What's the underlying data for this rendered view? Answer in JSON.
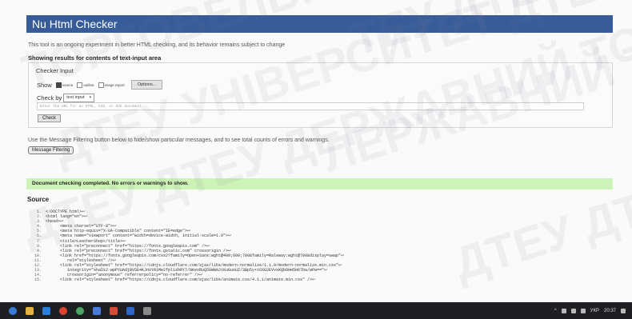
{
  "header": {
    "title": "Nu Html Checker"
  },
  "intro": "This tool is an ongoing experiment in better HTML checking, and its behavior remains subject to change",
  "showing": "Showing results for contents of text-input area",
  "checker": {
    "legend": "Checker Input",
    "show_label": "Show",
    "show_options": [
      {
        "label": "source",
        "checked": true
      },
      {
        "label": "outline",
        "checked": false
      },
      {
        "label": "image report",
        "checked": false
      }
    ],
    "options_button": "Options...",
    "check_by_label": "Check by",
    "check_by_value": "text input",
    "url_placeholder": "Enter the URL for an HTML, CSS, or SVG document",
    "check_button": "Check"
  },
  "filtering": {
    "text": "Use the Message Filtering button below to hide/show particular messages, and to see total counts of errors and warnings.",
    "button": "Message Filtering"
  },
  "status": "Document checking completed. No errors or warnings to show.",
  "source_heading": "Source",
  "code_lines": [
    {
      "n": "1.",
      "text": "<!DOCTYPE html>↩"
    },
    {
      "n": "2.",
      "text": "<html lang=\"en\">↩"
    },
    {
      "n": "3.",
      "text": "<head>↩"
    },
    {
      "n": "4.",
      "text": "      <meta charset=\"UTF-8\">↩"
    },
    {
      "n": "5.",
      "text": "      <meta http-equiv=\"X-UA-Compatible\" content=\"IE=edge\">↩"
    },
    {
      "n": "6.",
      "text": "      <meta name=\"viewport\" content=\"width=device-width, initial-scale=1.0\">↩"
    },
    {
      "n": "7.",
      "text": "      <title>LeatherShop</title>↩"
    },
    {
      "n": "8.",
      "text": "      <link rel=\"preconnect\" href=\"https://fonts.googleapis.com\" />↩"
    },
    {
      "n": "9.",
      "text": "      <link rel=\"preconnect\" href=\"https://fonts.gstatic.com\" crossorigin />↩"
    },
    {
      "n": "10.",
      "text": "      <link href=\"https://fonts.googleapis.com/css2?family=Open+Sans:wght@400;600;700&family=Raleway:wght@700&display=swap\"↩"
    },
    {
      "n": "11.",
      "text": "         rel=\"stylesheet\" />↩"
    },
    {
      "n": "12.",
      "text": "      <link rel=\"stylesheet\" href=\"https://cdnjs.cloudflare.com/ajax/libs/modern-normalize/1.1.0/modern-normalize.min.css\"↩"
    },
    {
      "n": "13.",
      "text": "         integrity=\"sha512-wpPYUAdjBVSE4KJnVtR1Me2fpl1sbRY7/NKexRuQ58WWA2tKuGuoUZ/3Bp5y+t6XG2EVvxKQb8HH5H67ba/wPw==\"↩"
    },
    {
      "n": "14.",
      "text": "         crossorigin=\"anonymous\" referrerpolicy=\"no-referrer\" />↩"
    },
    {
      "n": "15.",
      "text": "      <link rel=\"stylesheet\" href=\"https://cdnjs.cloudflare.com/ajax/libs/animate.css/4.1.1/animate.min.css\" />↩"
    }
  ],
  "watermark": [
    "ТЕУ ДТЕУ ДТЕУ",
    "ЛЕРЖАВНИЙ ТОРГ",
    "ДТЕУ УНІВЕРСИТЕТ ДТЕУ",
    "ДТЕУ ДТЕУ ДЕРЖАВНИЙ ТО",
    "ДТЕУ ДТЕУ ДТЕУ",
    "ТОРГОВЕЛЬНО"
  ],
  "taskbar": {
    "lang": "УКР",
    "time": "20:37"
  }
}
